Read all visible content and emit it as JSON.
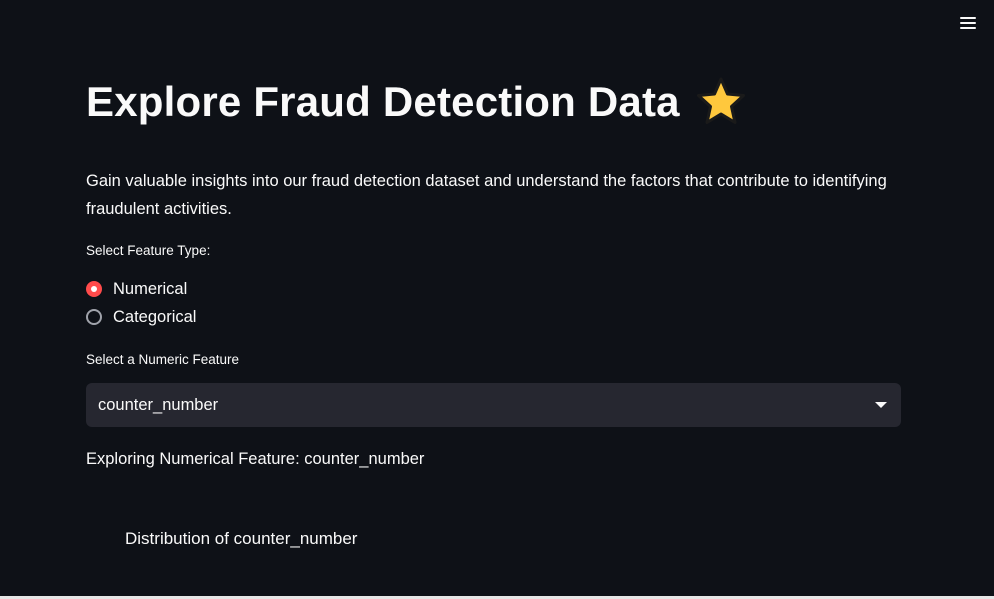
{
  "app": {
    "menu_icon": "hamburger-menu-icon"
  },
  "header": {
    "title": "Explore Fraud Detection Data",
    "title_icon": "star-icon"
  },
  "description": "Gain valuable insights into our fraud detection dataset and understand the factors that contribute to identifying fraudulent activities.",
  "feature_type": {
    "label": "Select Feature Type:",
    "options": [
      {
        "label": "Numerical",
        "selected": true
      },
      {
        "label": "Categorical",
        "selected": false
      }
    ]
  },
  "numeric_feature": {
    "label": "Select a Numeric Feature",
    "selected_value": "counter_number",
    "dropdown_icon": "chevron-down-icon"
  },
  "exploring_text": "Exploring Numerical Feature: counter_number",
  "chart": {
    "title": "Distribution of counter_number"
  },
  "colors": {
    "background": "#0e1117",
    "text": "#fafafa",
    "accent": "#ff4b4b",
    "input_bg": "#262730",
    "star": "#ffc83d"
  }
}
